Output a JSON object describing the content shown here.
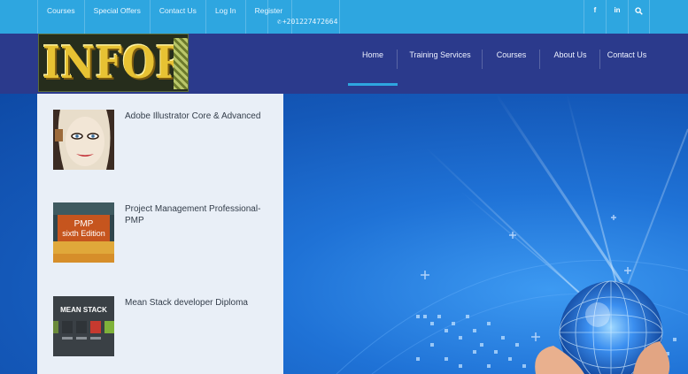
{
  "topbar": {
    "links": [
      "Courses",
      "Special Offers",
      "Contact Us",
      "Log In",
      "Register"
    ],
    "phone": "+201227472664",
    "social": [
      {
        "icon": "facebook-icon",
        "glyph": "f"
      },
      {
        "icon": "linkedin-icon",
        "glyph": "in"
      },
      {
        "icon": "search-icon",
        "glyph": "⚲"
      }
    ]
  },
  "header": {
    "logo_text": "INFORM",
    "nav": [
      "Home",
      "Training Services",
      "Courses",
      "About Us",
      "Contact Us"
    ],
    "active_nav": "Home"
  },
  "courses": [
    {
      "title": "Adobe Illustrator Core & Advanced"
    },
    {
      "title": "Project Management Professional-PMP",
      "thumb_line1": "PMP",
      "thumb_line2": "sixth Edition"
    },
    {
      "title": "Mean Stack developer Diploma",
      "thumb_label": "MEAN STACK"
    }
  ],
  "colors": {
    "topbar": "#2ea6e0",
    "header": "#2b3a8c",
    "panel": "#e9eff7",
    "accent": "#2ea6e0"
  }
}
